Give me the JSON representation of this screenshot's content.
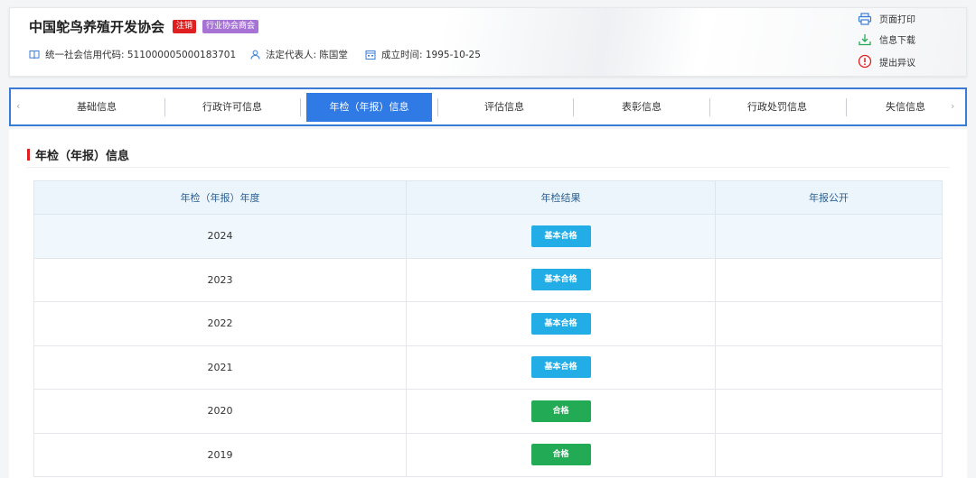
{
  "header": {
    "org_name": "中国鸵鸟养殖开发协会",
    "badge_status": "注销",
    "badge_type": "行业协会商会",
    "credit_code": "统一社会信用代码: 511000005000183701",
    "legal_rep": "法定代表人: 陈国堂",
    "founded": "成立时间: 1995-10-25",
    "actions": {
      "print": "页面打印",
      "download": "信息下载",
      "objection": "提出异议"
    }
  },
  "tabs": [
    {
      "label": "基础信息"
    },
    {
      "label": "行政许可信息"
    },
    {
      "label": "年检（年报）信息",
      "active": true
    },
    {
      "label": "评估信息"
    },
    {
      "label": "表彰信息"
    },
    {
      "label": "行政处罚信息"
    },
    {
      "label": "失信信息"
    }
  ],
  "section": {
    "title": "年检（年报）信息"
  },
  "table": {
    "headers": [
      "年检（年报）年度",
      "年检结果",
      "年报公开"
    ],
    "rows": [
      {
        "year": "2024",
        "result": "基本合格",
        "public": ""
      },
      {
        "year": "2023",
        "result": "基本合格",
        "public": ""
      },
      {
        "year": "2022",
        "result": "基本合格",
        "public": ""
      },
      {
        "year": "2021",
        "result": "基本合格",
        "public": ""
      },
      {
        "year": "2020",
        "result": "合格",
        "public": ""
      },
      {
        "year": "2019",
        "result": "合格",
        "public": ""
      }
    ]
  },
  "colors": {
    "accent": "#2f7ae5",
    "status_basic": "#22ade6",
    "status_pass": "#22aa55",
    "badge_red": "#e02020",
    "badge_purple": "#a774d6"
  },
  "icons": [
    "book-icon",
    "user-icon",
    "calendar-icon",
    "printer-icon",
    "download-icon",
    "alert-icon",
    "chevron-left-icon",
    "chevron-right-icon"
  ]
}
